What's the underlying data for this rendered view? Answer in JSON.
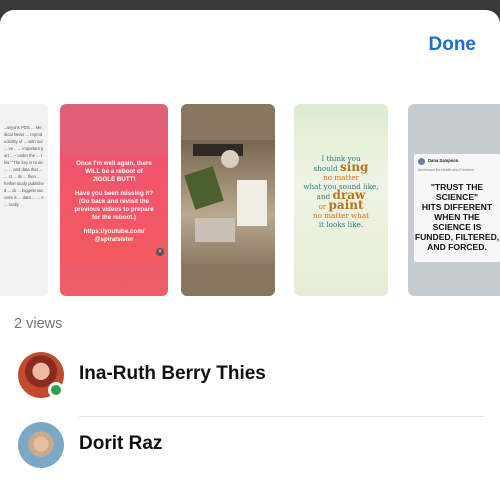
{
  "header": {
    "done_label": "Done"
  },
  "stories": [
    {
      "text": "..anyons PDG ... Medical News ... reproducibility of ... with our ... ve .. ... important part ... - under the ... this: \"The key is to do ... ... and data that ... ... ct ... its ... then ... hether study published ... ck ... biggest success is ... data ... ... e ... really"
    },
    {
      "lines": [
        "Once I'm well again, there",
        "WILL be a reboot of",
        "JIGGLE BUTT!",
        "",
        "Have you been missing it?",
        "(Go back and revisit the",
        "previous videos to prepare",
        "for the reboot.)",
        "",
        "https://youtube.com/",
        "@spiralsister"
      ]
    },
    {
      "photo": "crafts"
    },
    {
      "quote": [
        "I think you",
        "should",
        "sing",
        "no matter",
        "what you sound like,",
        "and",
        "draw",
        "or",
        "paint",
        "no matter what",
        "it looks like."
      ]
    },
    {
      "tweet_name": "Dana Sampson",
      "tweet_handle": "Americans for Health and Freedom",
      "tweet_body": "\"TRUST THE\nSCIENCE\"\nHITS DIFFERENT\nWHEN THE\nSCIENCE IS\nFUNDED, FILTERED,\nAND FORCED."
    }
  ],
  "views": {
    "count_label": "2 views"
  },
  "viewers": [
    {
      "name": "Ina-Ruth Berry Thies",
      "online": true
    },
    {
      "name": "Dorit Raz",
      "online": false
    }
  ],
  "colors": {
    "accent": "#1a6fd6",
    "online": "#31a24c"
  }
}
